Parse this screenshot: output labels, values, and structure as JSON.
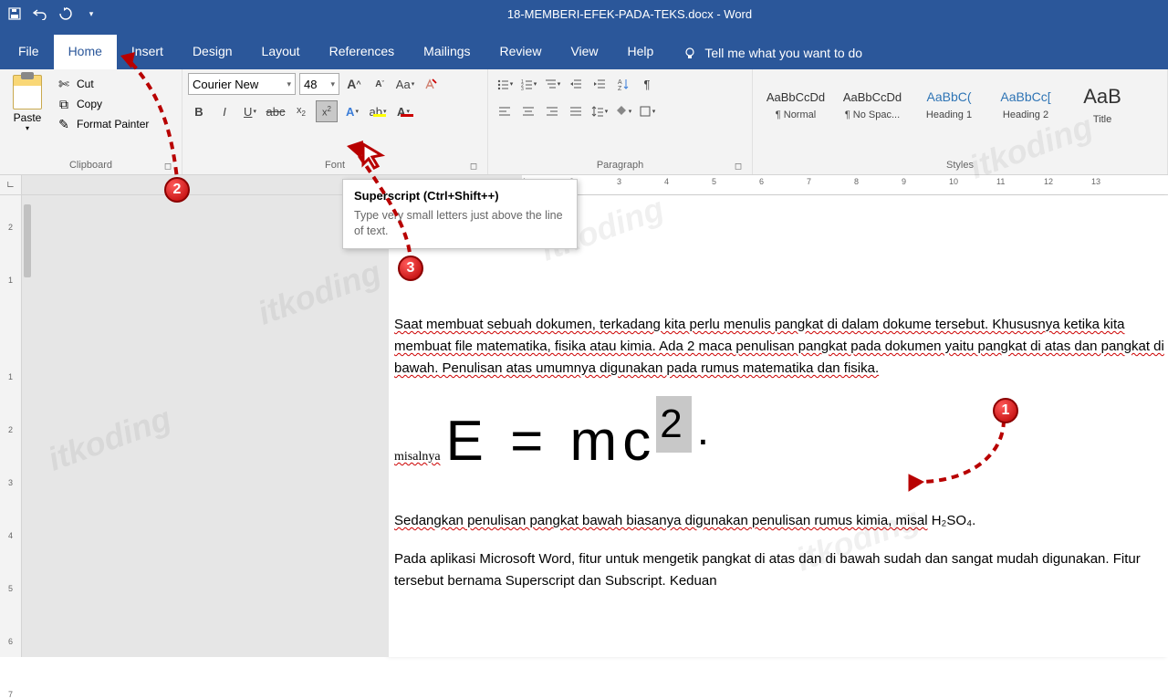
{
  "title_bar": {
    "document_title": "18-MEMBERI-EFEK-PADA-TEKS.docx",
    "app_name": "Word",
    "separator": " - "
  },
  "tabs": {
    "file": "File",
    "home": "Home",
    "insert": "Insert",
    "design": "Design",
    "layout": "Layout",
    "references": "References",
    "mailings": "Mailings",
    "review": "Review",
    "view": "View",
    "help": "Help",
    "tell_me": "Tell me what you want to do"
  },
  "ribbon": {
    "clipboard": {
      "paste": "Paste",
      "cut": "Cut",
      "copy": "Copy",
      "format_painter": "Format Painter",
      "label": "Clipboard"
    },
    "font": {
      "name": "Courier New",
      "size": "48",
      "label": "Font"
    },
    "paragraph": {
      "label": "Paragraph"
    },
    "styles": {
      "label": "Styles",
      "items": [
        {
          "preview": "AaBbCcDd",
          "name": "¶ Normal",
          "class": ""
        },
        {
          "preview": "AaBbCcDd",
          "name": "¶ No Spac...",
          "class": ""
        },
        {
          "preview": "AaBbC(",
          "name": "Heading 1",
          "class": "heading"
        },
        {
          "preview": "AaBbCc[",
          "name": "Heading 2",
          "class": "heading"
        },
        {
          "preview": "AaB",
          "name": "Title",
          "class": "title"
        }
      ]
    }
  },
  "tooltip": {
    "title": "Superscript (Ctrl+Shift++)",
    "desc": "Type very small letters just above the line of text."
  },
  "document": {
    "para1": "Saat membuat sebuah dokumen, terkadang kita perlu menulis pangkat di dalam dokume tersebut. Khususnya ketika kita membuat file matematika, fisika atau kimia. Ada 2 maca penulisan pangkat pada dokumen yaitu pangkat di atas dan pangkat di bawah. Penulisan atas umumnya digunakan pada rumus matematika dan fisika.",
    "formula_prefix": "misalnya",
    "formula_main": "E = mc",
    "formula_sup": "2",
    "formula_dot": ".",
    "para2_text": "Sedangkan penulisan pangkat bawah biasanya digunakan penulisan rumus kimia, misal",
    "chem": "H₂SO₄.",
    "para3": "Pada aplikasi Microsoft Word, fitur untuk mengetik pangkat di atas dan di bawah sudah dan sangat mudah digunakan. Fitur tersebut bernama Superscript dan Subscript. Keduan"
  },
  "ruler": {
    "ticks": [
      "1",
      "2",
      "3",
      "4",
      "5",
      "6",
      "7",
      "8",
      "9",
      "10",
      "11",
      "12",
      "13"
    ]
  },
  "vruler": {
    "ticks": [
      "2",
      "1",
      "",
      "1",
      "2",
      "3",
      "4",
      "5",
      "6",
      "7"
    ]
  },
  "annotations": {
    "n1": "1",
    "n2": "2",
    "n3": "3"
  },
  "watermark": "itkoding"
}
